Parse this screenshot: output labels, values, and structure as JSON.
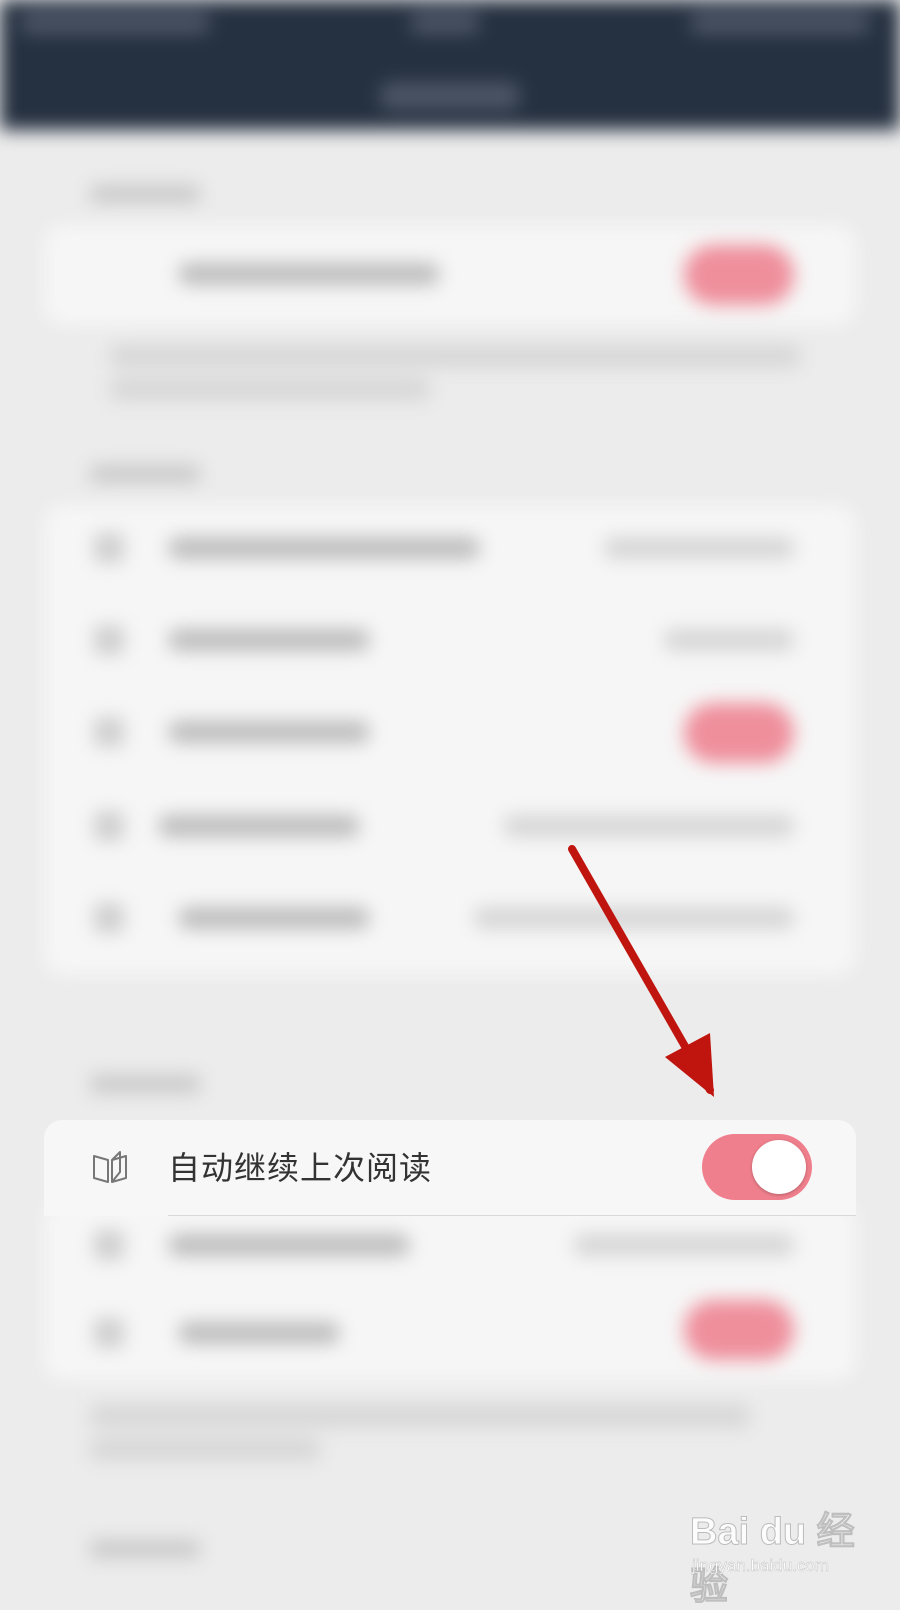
{
  "setting_row": {
    "label": "自动继续上次阅读",
    "icon": "open-book-icon",
    "toggle_on": true
  },
  "colors": {
    "toggle_on": "#ef7f8c",
    "arrow": "#c0150f",
    "header_bg": "#253040"
  },
  "watermark": {
    "brand": "Bai du 经验",
    "url": "jingyan.baidu.com"
  }
}
